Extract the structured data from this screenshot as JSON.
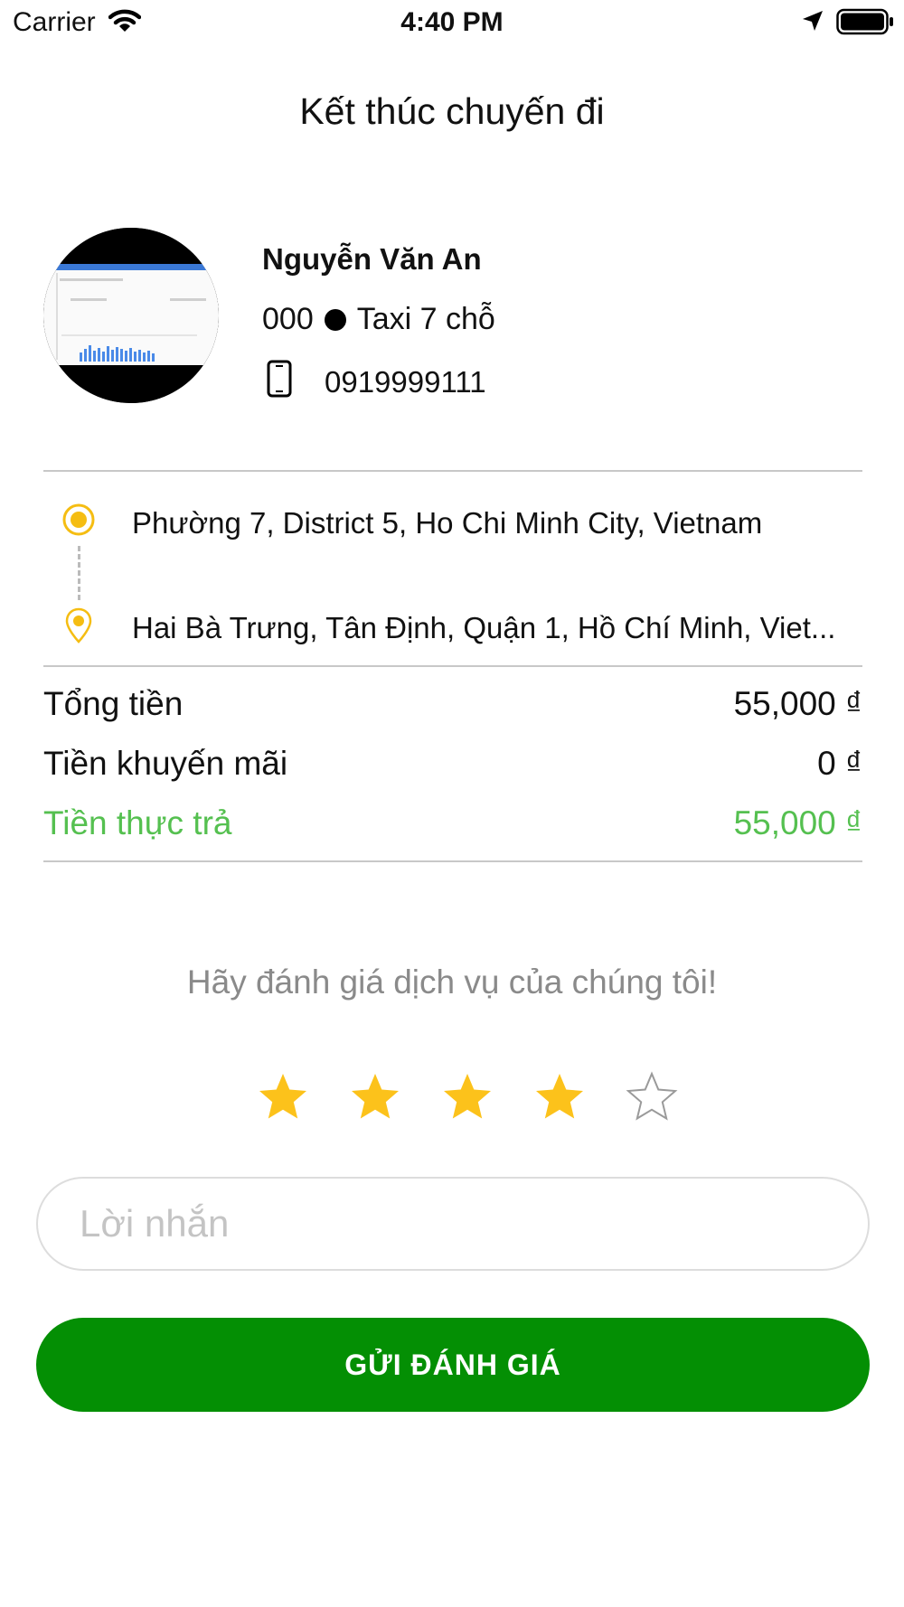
{
  "status_bar": {
    "carrier": "Carrier",
    "time": "4:40 PM",
    "icons": [
      "wifi-icon",
      "location-arrow-icon",
      "battery-icon"
    ]
  },
  "header": {
    "title": "Kết thúc chuyến đi"
  },
  "driver": {
    "name": "Nguyễn Văn An",
    "plate": "000",
    "vehicle_type": "Taxi 7 chỗ",
    "phone": "0919999111",
    "icons": [
      "avatar",
      "phone-icon"
    ]
  },
  "route": {
    "origin": "Phường 7, District 5, Ho Chi Minh City, Vietnam",
    "destination": "Hai Bà Trưng, Tân Định, Quận 1, Hồ Chí Minh, Viet...",
    "origin_color": "#f5bd12",
    "icons": [
      "origin-marker-icon",
      "destination-pin-icon"
    ]
  },
  "fare": {
    "total_label": "Tổng tiền",
    "total_value": "55,000 ₫",
    "discount_label": "Tiền khuyến mãi",
    "discount_value": "0 ₫",
    "paid_label": "Tiền thực trả",
    "paid_value": "55,000 ₫",
    "paid_color": "#55c050"
  },
  "rating": {
    "prompt": "Hãy đánh giá dịch vụ của chúng tôi!",
    "value": 4,
    "max": 5,
    "star_color": "#fcc21b"
  },
  "message": {
    "placeholder": "Lời nhắn"
  },
  "submit": {
    "label": "GỬI ĐÁNH GIÁ",
    "color": "#048f04"
  }
}
